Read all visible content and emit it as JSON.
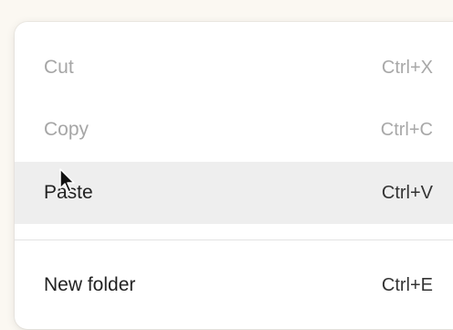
{
  "context_menu": {
    "items": [
      {
        "label": "Cut",
        "shortcut": "Ctrl+X",
        "enabled": false
      },
      {
        "label": "Copy",
        "shortcut": "Ctrl+C",
        "enabled": false
      },
      {
        "label": "Paste",
        "shortcut": "Ctrl+V",
        "enabled": true,
        "hovered": true
      },
      {
        "label": "New folder",
        "shortcut": "Ctrl+E",
        "enabled": true
      }
    ]
  },
  "cursor": {
    "icon": "arrow-pointer-icon"
  }
}
